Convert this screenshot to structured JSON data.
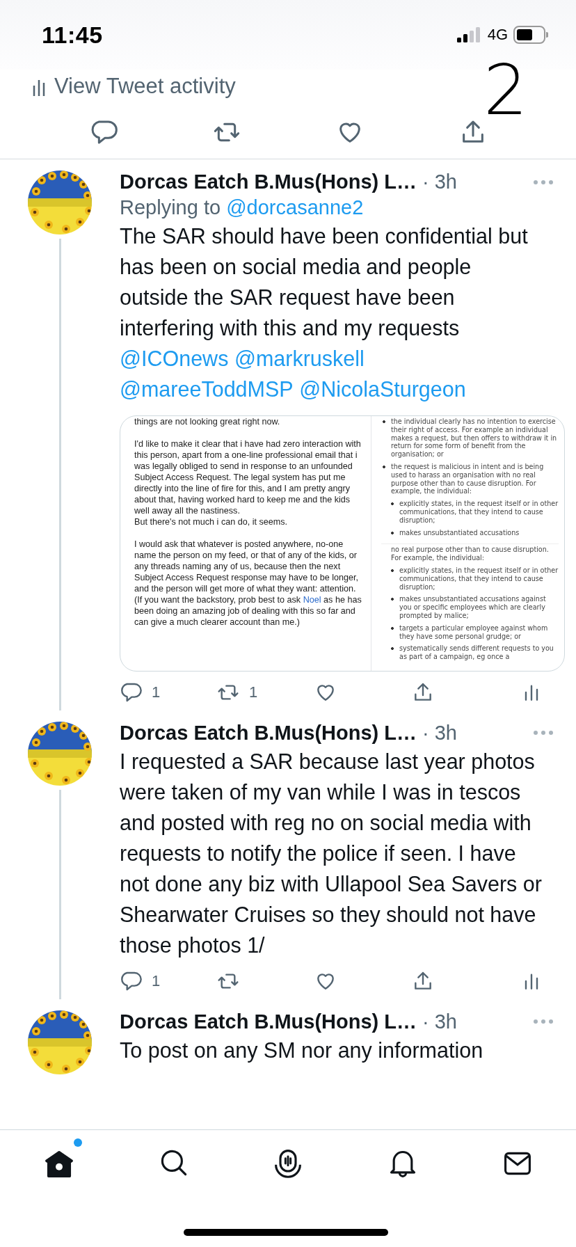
{
  "status_bar": {
    "time": "11:45",
    "network": "4G"
  },
  "activity_link": "View Tweet activity",
  "annotation": "2",
  "main_actions": [
    {
      "kind": "reply"
    },
    {
      "kind": "retweet"
    },
    {
      "kind": "like"
    },
    {
      "kind": "share"
    }
  ],
  "tweets": [
    {
      "author": "Dorcas Eatch B.Mus(Hons) L…",
      "time": "· 3h",
      "replying_to": {
        "prefix": "Replying to",
        "handle": "@dorcasanne2"
      },
      "text": [
        {
          "kind": "plain",
          "text": "The SAR should have been confidential but has been on social media and people outside the SAR request have been interfering with this and my requests "
        },
        {
          "kind": "mention",
          "text": "@ICOnews"
        },
        {
          "kind": "mention",
          "text": "@markruskell"
        },
        {
          "kind": "mention",
          "text": "@mareeToddMSP"
        },
        {
          "kind": "mention",
          "text": "@NicolaSturgeon"
        }
      ],
      "attachment": {
        "left_paragraphs": [
          [
            [
              {
                "kind": "plain",
                "text": "things are not looking great right now."
              }
            ]
          ],
          [
            [
              {
                "kind": "plain",
                "text": "I'd like to make it clear that i have had zero interaction with this person, apart from a one-line professional email that i was legally obliged to send in response to an unfounded Subject Access Request. The legal system has put me directly into the line of fire for this, and I am pretty angry about that, having worked hard to keep me and the kids well away all the nastiness."
              }
            ],
            [
              {
                "kind": "plain",
                "text": "But there's not much i can do, it seems."
              }
            ]
          ],
          [
            [
              {
                "kind": "plain",
                "text": "I would ask that whatever is posted anywhere, no-one name the person on my feed, or that of any of the kids, or any threads naming any of us, because then the next Subject Access Request response may have to be longer, and the person will get more of what they want: attention."
              }
            ],
            [
              {
                "kind": "plain",
                "text": "(If you want the backstory, prob best to ask "
              },
              {
                "kind": "mention",
                "text": "Noel"
              },
              {
                "kind": "plain",
                "text": " as he has been doing an amazing job of dealing with this so far and can give a much clearer account than me.)"
              }
            ]
          ]
        ],
        "right_panels": [
          {
            "items": [
              {
                "kind": "bullet",
                "text": "the individual clearly has no intention to exercise their right of access. For example an individual makes a request, but then offers to withdraw it in return for some form of benefit from the organisation; or"
              },
              {
                "kind": "bullet",
                "text": "the request is malicious in intent and is being used to harass an organisation with no real purpose other than to cause disruption. For example, the individual:",
                "children": [
                  {
                    "kind": "bullet",
                    "text": "explicitly states, in the request itself or in other communications, that they intend to cause disruption;"
                  },
                  {
                    "kind": "bullet",
                    "text": "makes unsubstantiated accusations"
                  }
                ]
              }
            ]
          },
          {
            "items": [
              {
                "kind": "continuation",
                "text": "no real purpose other than to cause disruption. For example, the individual:",
                "children": [
                  {
                    "kind": "bullet",
                    "text": "explicitly states, in the request itself or in other communications, that they intend to cause disruption;"
                  },
                  {
                    "kind": "bullet",
                    "text": "makes unsubstantiated accusations against you or specific employees which are clearly prompted by malice;"
                  },
                  {
                    "kind": "bullet",
                    "text": "targets a particular employee against whom they have some personal grudge; or"
                  },
                  {
                    "kind": "bullet",
                    "text": "systematically sends different requests to you as part of a campaign, eg once a"
                  }
                ]
              }
            ]
          }
        ]
      },
      "reply_count": "1",
      "retweet_count": "1"
    },
    {
      "author": "Dorcas Eatch B.Mus(Hons) L…",
      "time": "· 3h",
      "text": [
        {
          "kind": "plain",
          "text": "I requested a SAR because last year photos were taken of my van while I was in tescos and posted with reg no on social media with requests to notify the police if seen. I have not done any biz with Ullapool Sea Savers or Shearwater Cruises so they should not have those photos 1/"
        }
      ],
      "reply_count": "1"
    },
    {
      "author": "Dorcas Eatch B.Mus(Hons) L…",
      "time": "· 3h",
      "text": [
        {
          "kind": "plain",
          "text": "To post on any SM nor any information"
        }
      ]
    }
  ],
  "tab_bar": [
    {
      "kind": "home",
      "selected": true,
      "has_new": true
    },
    {
      "kind": "search",
      "selected": false
    },
    {
      "kind": "spaces",
      "selected": false
    },
    {
      "kind": "notifications",
      "selected": false
    },
    {
      "kind": "messages",
      "selected": false
    }
  ]
}
